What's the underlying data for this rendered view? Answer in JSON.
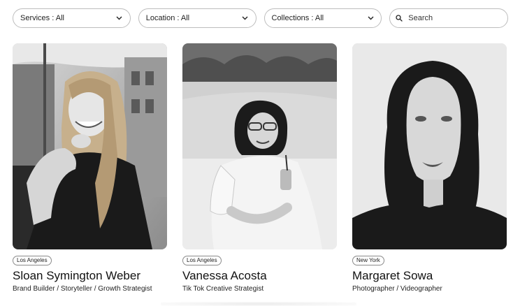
{
  "filters": {
    "services_label": "Services : All",
    "location_label": "Location : All",
    "collections_label": "Collections : All",
    "search_placeholder": "Search"
  },
  "icons": {
    "dropdown": "chevron-down-icon",
    "search": "search-icon"
  },
  "creators": [
    {
      "location": "Los Angeles",
      "name": "Sloan Symington Weber",
      "role": "Brand Builder / Storyteller / Growth Strategist"
    },
    {
      "location": "Los Angeles",
      "name": "Vanessa Acosta",
      "role": "Tik Tok Creative Strategist"
    },
    {
      "location": "New York",
      "name": "Margaret Sowa",
      "role": "Photographer / Videographer"
    }
  ],
  "colors": {
    "border": "#bdbdbd",
    "text": "#111111"
  }
}
